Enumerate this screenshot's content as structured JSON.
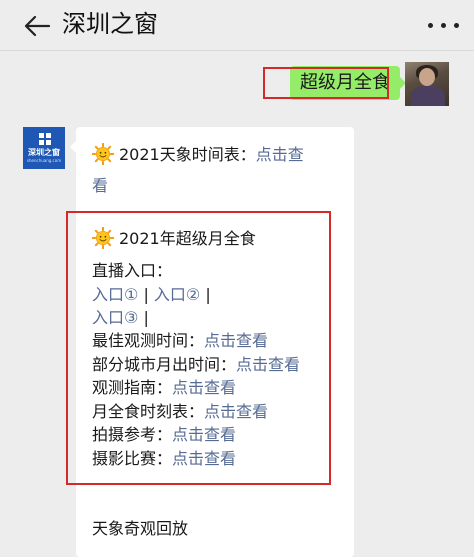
{
  "header": {
    "title": "深圳之窗"
  },
  "my_message": {
    "text": "超级月全食"
  },
  "bot": {
    "avatar_brand": "深圳之窗",
    "avatar_sub": "shenchuang.com"
  },
  "message": {
    "intro_title": "2021天象时间表：",
    "intro_link_1": "点击查",
    "intro_link_2": "看",
    "event_title": "2021年超级月全食",
    "live_label": "直播入口：",
    "entry_1": "入口①",
    "sep": " | ",
    "entry_2": "入口②",
    "entry_3": "入口③",
    "sep_end": " |",
    "items": [
      {
        "label": "最佳观测时间：",
        "link": "点击查看"
      },
      {
        "label": "部分城市月出时间：",
        "link": "点击查看"
      },
      {
        "label": "观测指南：",
        "link": "点击查看"
      },
      {
        "label": "月全食时刻表：",
        "link": "点击查看"
      },
      {
        "label": "拍摄参考：",
        "link": "点击查看"
      },
      {
        "label": "摄影比赛：",
        "link": "点击查看"
      }
    ],
    "footer": "天象奇观回放"
  },
  "colors": {
    "link": "#576b95",
    "highlight_box": "#d42a2a",
    "my_bubble": "#95ec69"
  },
  "icons": {
    "back": "arrow-left-icon",
    "menu": "more-dots-icon",
    "sun": "sun-emoji-icon"
  }
}
